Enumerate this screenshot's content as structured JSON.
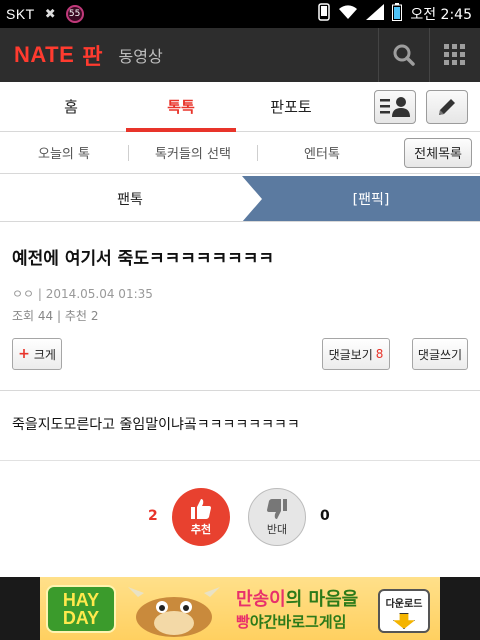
{
  "status_bar": {
    "carrier": "SKT",
    "badge": "55",
    "time": "오전 2:45",
    "icons": [
      "close-x-icon",
      "phone-icon",
      "wifi-icon",
      "signal-icon",
      "battery-icon"
    ]
  },
  "app_header": {
    "brand": "NATE",
    "section": "판",
    "video_link": "동영상",
    "icons": [
      "search-icon",
      "grid-menu-icon"
    ]
  },
  "main_tabs": {
    "items": [
      "홈",
      "톡톡",
      "판포토"
    ],
    "active": "톡톡",
    "right_buttons": [
      "profile-list-icon",
      "pencil-icon"
    ],
    "accent_color": "#e8342a"
  },
  "sub_tabs": {
    "items": [
      "오늘의 톡",
      "톡커들의 선택",
      "엔터톡"
    ],
    "all_list_button": "전체목록"
  },
  "fan_tabs": {
    "left": "팬톡",
    "right": "[팬픽]",
    "active_color": "#5b7aa0"
  },
  "post": {
    "title": "예전에 여기서 죽도ㅋㅋㅋㅋㅋㅋㅋㅋ",
    "author": "ㅇㅇ",
    "date": "2014.05.04 01:35",
    "views_label": "조회",
    "views": "44",
    "recommend_label": "추천",
    "recommend": "2",
    "enlarge_button": "크게",
    "view_comments_button": "댓글보기",
    "comment_count": "8",
    "write_comment_button": "댓글쓰기",
    "content": "죽을지도모른다고 줄임말이냐곸ㅋㅋㅋㅋㅋㅋㅋㅋ"
  },
  "votes": {
    "up_count": "2",
    "up_label": "추천",
    "down_count": "0",
    "down_label": "반대"
  },
  "ad": {
    "logo_line1": "HAY",
    "logo_line2": "DAY",
    "headline_a": "만송이",
    "headline_b": "의 마음을",
    "subline_a": "빵",
    "subline_b": "야간바로그게임",
    "download": "다운로드"
  }
}
